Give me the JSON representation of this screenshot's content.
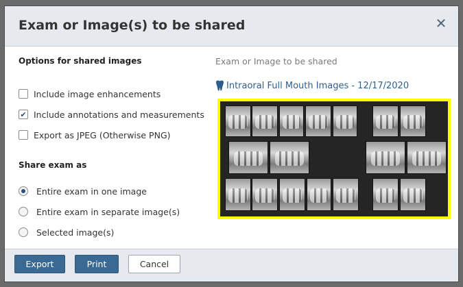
{
  "dialog": {
    "title": "Exam or Image(s) to be shared",
    "close_icon": "close-icon"
  },
  "options": {
    "heading": "Options for shared images",
    "items": [
      {
        "label": "Include image enhancements",
        "checked": false
      },
      {
        "label": "Include annotations and measurements",
        "checked": true
      },
      {
        "label": "Export as JPEG (Otherwise PNG)",
        "checked": false
      }
    ]
  },
  "share": {
    "heading": "Share exam as",
    "items": [
      {
        "label": "Entire exam in one image",
        "selected": true
      },
      {
        "label": "Entire exam in separate image(s)",
        "selected": false
      },
      {
        "label": "Selected image(s)",
        "selected": false
      }
    ]
  },
  "preview": {
    "label": "Exam or Image to be shared",
    "exam_title": "Intraoral Full Mouth Images - 12/17/2020",
    "exam_icon": "tooth-icon",
    "highlight_color": "#ffff00"
  },
  "footer": {
    "export_label": "Export",
    "print_label": "Print",
    "cancel_label": "Cancel"
  }
}
